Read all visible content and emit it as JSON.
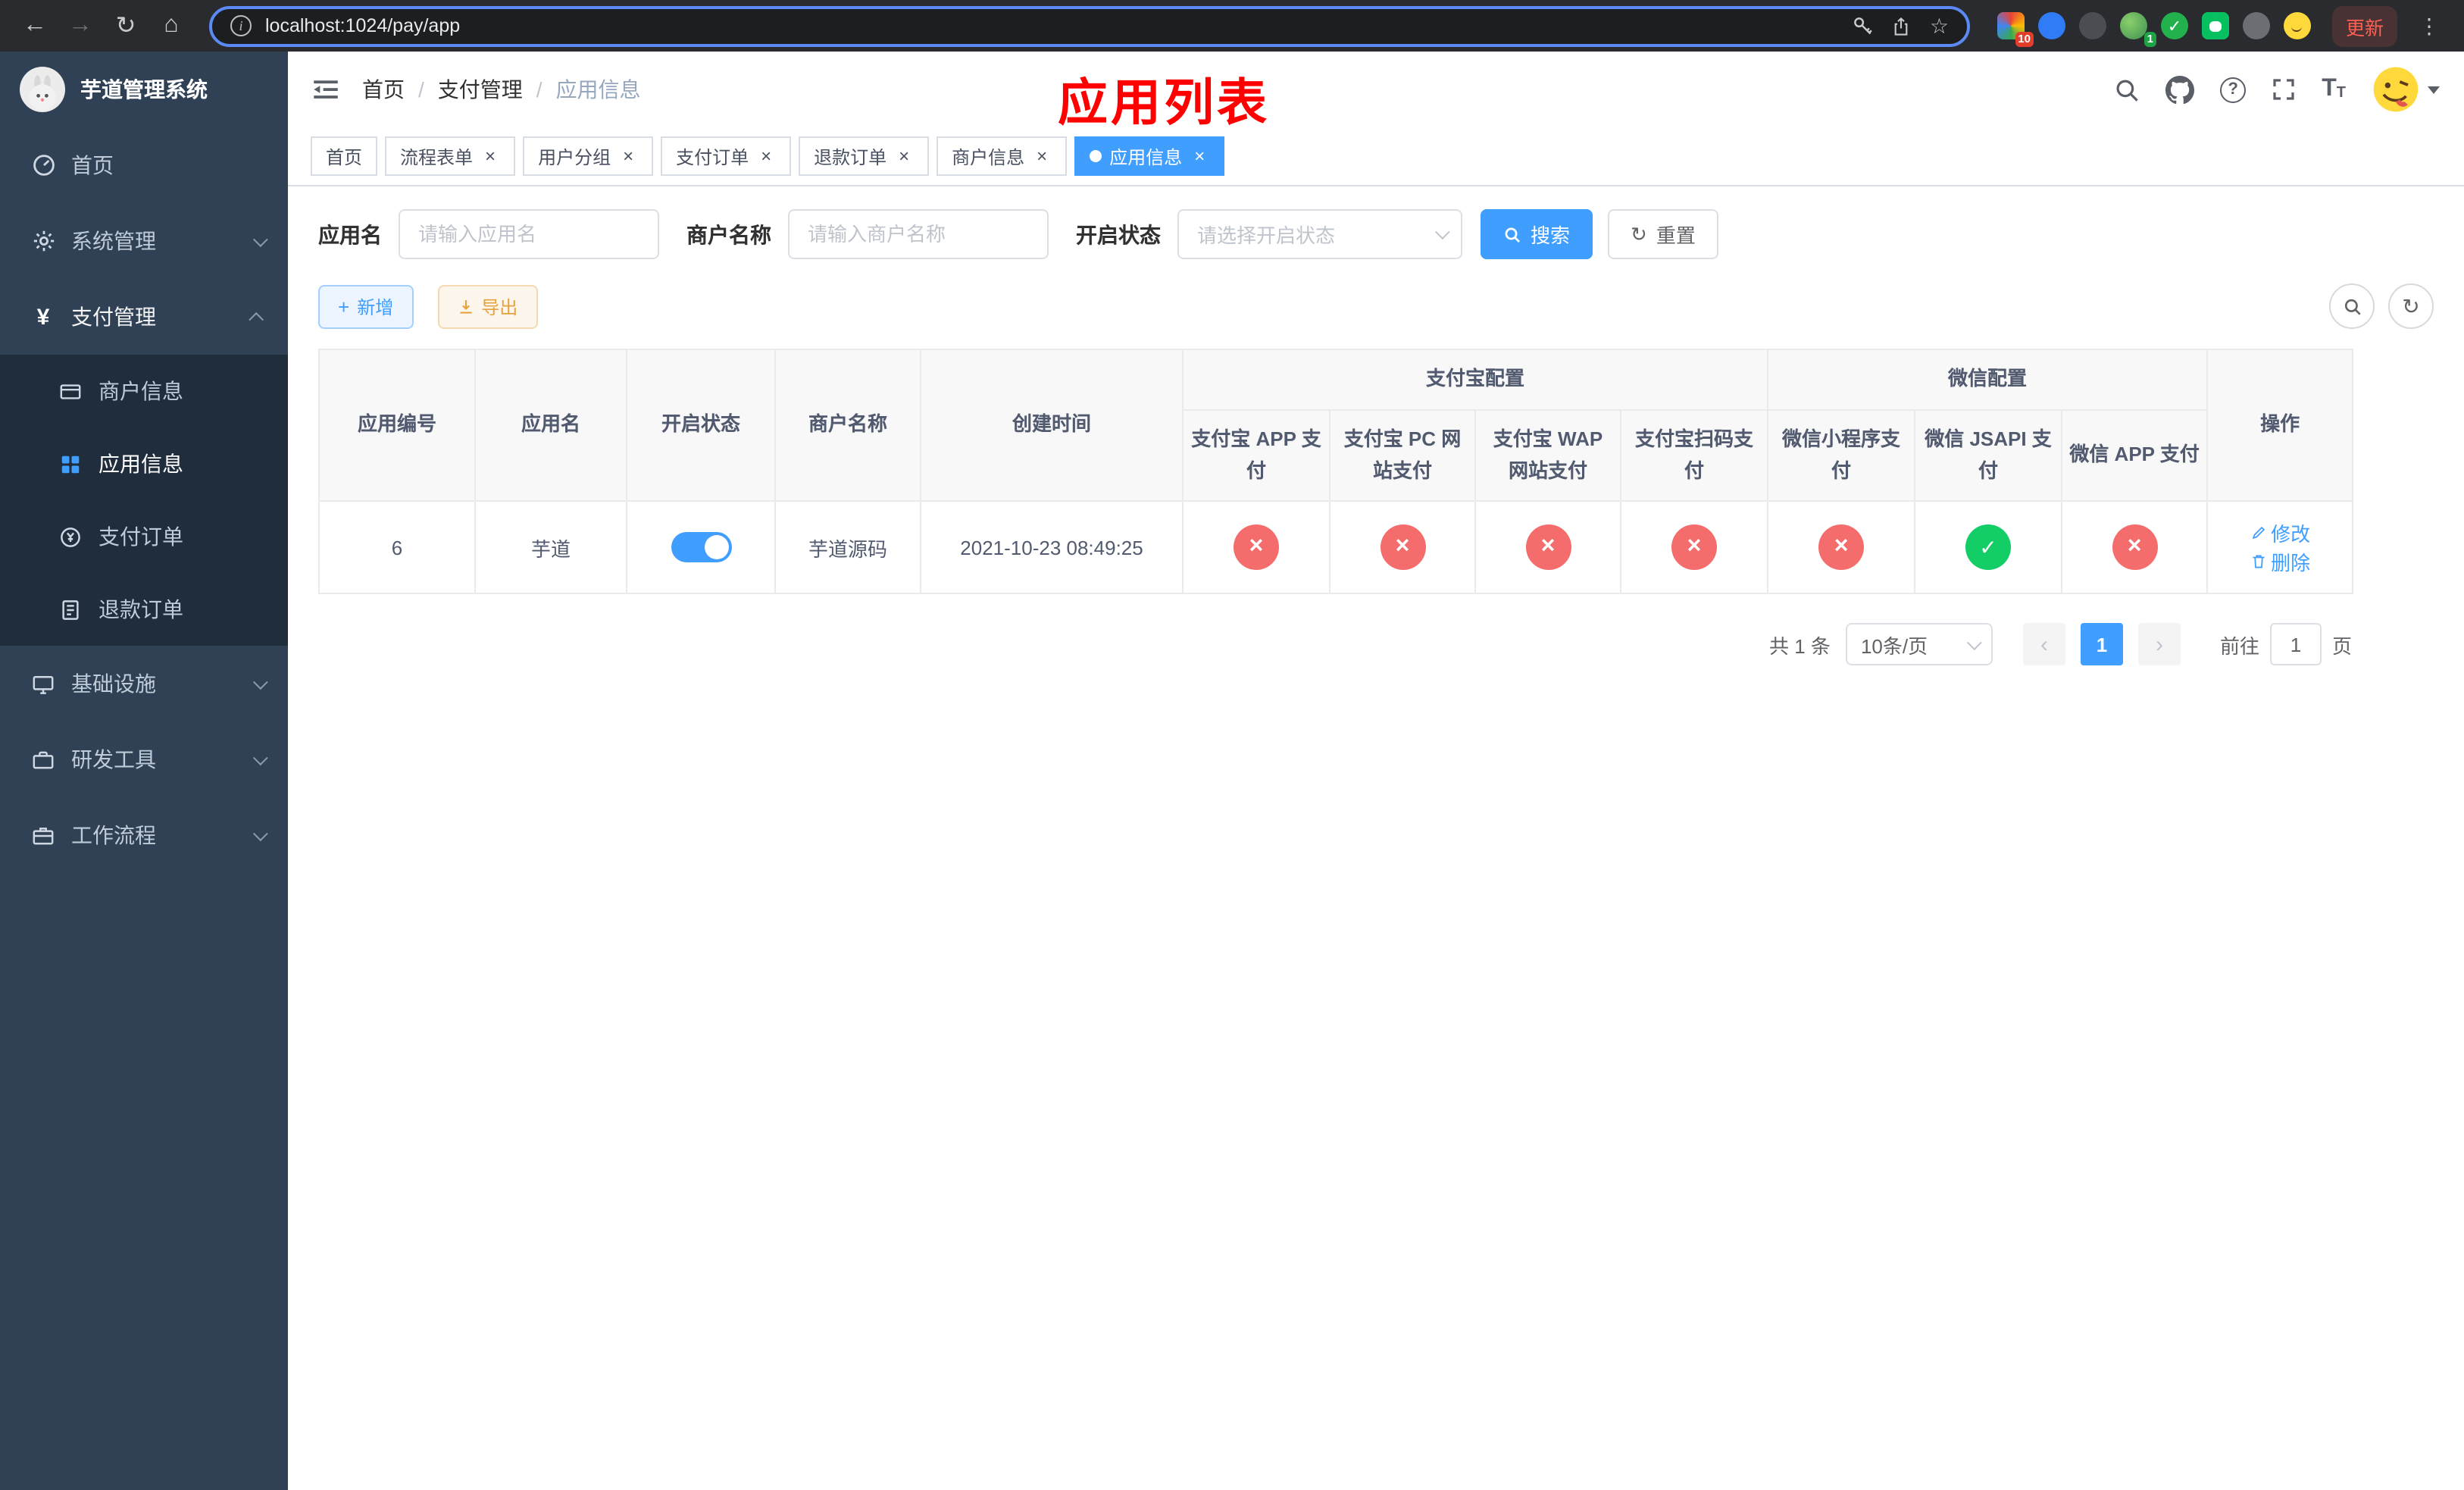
{
  "browser": {
    "url": "localhost:1024/pay/app",
    "update_button": "更新",
    "extension_badge": "10",
    "profile_badge": "1"
  },
  "colors": {
    "accent": "#409eff",
    "danger": "#f56c6c",
    "success": "#13ce66",
    "warning": "#e6a23c",
    "annotation_red": "#ff0000",
    "sidebar_bg": "#304156",
    "sidebar_submenu_bg": "#1f2d3d"
  },
  "sidebar": {
    "title": "芋道管理系统",
    "items": {
      "home": "首页",
      "system": "系统管理",
      "payment": "支付管理",
      "merchant": "商户信息",
      "app": "应用信息",
      "pay_order": "支付订单",
      "refund_order": "退款订单",
      "infra": "基础设施",
      "devtools": "研发工具",
      "workflow": "工作流程"
    }
  },
  "navbar": {
    "breadcrumb": {
      "home": "首页",
      "section": "支付管理",
      "current": "应用信息"
    }
  },
  "annotation": {
    "title": "应用列表"
  },
  "tabs": [
    {
      "label": "首页",
      "closable": false,
      "active": false
    },
    {
      "label": "流程表单",
      "closable": true,
      "active": false
    },
    {
      "label": "用户分组",
      "closable": true,
      "active": false
    },
    {
      "label": "支付订单",
      "closable": true,
      "active": false
    },
    {
      "label": "退款订单",
      "closable": true,
      "active": false
    },
    {
      "label": "商户信息",
      "closable": true,
      "active": false
    },
    {
      "label": "应用信息",
      "closable": true,
      "active": true
    }
  ],
  "filters": {
    "app_name_label": "应用名",
    "app_name_placeholder": "请输入应用名",
    "merchant_label": "商户名称",
    "merchant_placeholder": "请输入商户名称",
    "status_label": "开启状态",
    "status_placeholder": "请选择开启状态",
    "search_button": "搜索",
    "reset_button": "重置"
  },
  "toolbar": {
    "add_button": "新增",
    "export_button": "导出"
  },
  "table": {
    "headers": {
      "app_id": "应用编号",
      "app_name": "应用名",
      "status": "开启状态",
      "merchant": "商户名称",
      "created": "创建时间",
      "alipay_group": "支付宝配置",
      "wechat_group": "微信配置",
      "alipay_app": "支付宝 APP 支付",
      "alipay_pc": "支付宝 PC 网站支付",
      "alipay_wap": "支付宝 WAP 网站支付",
      "alipay_scan": "支付宝扫码支付",
      "wechat_mini": "微信小程序支付",
      "wechat_jsapi": "微信 JSAPI 支付",
      "wechat_app": "微信 APP 支付",
      "actions": "操作"
    },
    "rows": [
      {
        "app_id": "6",
        "app_name": "芋道",
        "status_enabled": true,
        "merchant": "芋道源码",
        "created": "2021-10-23 08:49:25",
        "alipay_app": false,
        "alipay_pc": false,
        "alipay_wap": false,
        "alipay_scan": false,
        "wechat_mini": false,
        "wechat_jsapi": true,
        "wechat_app": false,
        "edit_label": "修改",
        "delete_label": "删除"
      }
    ]
  },
  "pagination": {
    "total": "共 1 条",
    "page_size": "10条/页",
    "current_page": "1",
    "goto_label": "前往",
    "goto_value": "1",
    "page_unit": "页"
  }
}
